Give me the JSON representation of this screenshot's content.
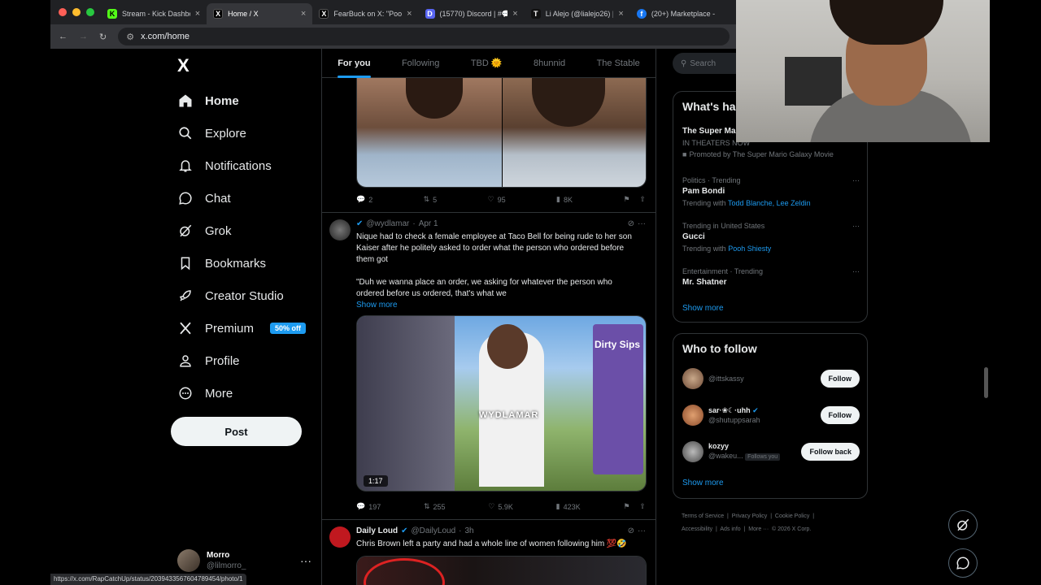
{
  "browser": {
    "tabs": [
      {
        "title": "Stream - Kick Dashbo",
        "icon": "K",
        "icon_color": "#53fc18",
        "active": false
      },
      {
        "title": "Home / X",
        "icon": "X",
        "icon_color": "#000000",
        "active": true
      },
      {
        "title": "FearBuck on X: \"Pooh",
        "icon": "X",
        "icon_color": "#000000",
        "active": false
      },
      {
        "title": "(15770) Discord | #💬",
        "icon": "D",
        "icon_color": "#5865f2",
        "active": false
      },
      {
        "title": "Li Alejo (@lialejo26) |",
        "icon": "T",
        "icon_color": "#111111",
        "active": false
      },
      {
        "title": "(20+) Marketplace -",
        "icon": "f",
        "icon_color": "#1877f2",
        "active": false
      }
    ],
    "url": "x.com/home",
    "status_url": "https://x.com/RapCatchUp/status/2039433567604789454/photo/1"
  },
  "nav": {
    "logo": "X",
    "items": [
      {
        "label": "Home",
        "icon": "home-icon",
        "active": true
      },
      {
        "label": "Explore",
        "icon": "search-icon"
      },
      {
        "label": "Notifications",
        "icon": "bell-icon"
      },
      {
        "label": "Chat",
        "icon": "chat-icon"
      },
      {
        "label": "Grok",
        "icon": "grok-icon"
      },
      {
        "label": "Bookmarks",
        "icon": "bookmark-icon"
      },
      {
        "label": "Creator Studio",
        "icon": "rocket-icon"
      },
      {
        "label": "Premium",
        "icon": "x-icon",
        "badge": "50% off"
      },
      {
        "label": "Profile",
        "icon": "person-icon"
      },
      {
        "label": "More",
        "icon": "more-circle-icon"
      }
    ],
    "post_label": "Post",
    "account": {
      "name": "Morro",
      "handle": "@lilmorro_"
    }
  },
  "timeline": {
    "tabs": [
      "For you",
      "Following",
      "TBD 🌞",
      "8hunnid",
      "The Stable"
    ],
    "post1_actions": {
      "replies": "2",
      "reposts": "5",
      "likes": "95",
      "views": "8K"
    },
    "post2": {
      "handle": "@wydlamar",
      "date": "Apr 1",
      "text1": "Nique had to check a female employee at Taco Bell for being rude to her son Kaiser after he politely asked to order what the person who ordered before them got",
      "text2": "\"Duh we wanna place an order, we asking for whatever the person who ordered before us ordered, that's what we",
      "show_more": "Show more",
      "duration": "1:17",
      "watermark": "WYDLAMAR",
      "sign_text": "Dirty Sips",
      "actions": {
        "replies": "197",
        "reposts": "255",
        "likes": "5.9K",
        "views": "423K"
      }
    },
    "post3": {
      "name": "Daily Loud",
      "handle": "@DailyLoud",
      "date": "3h",
      "text": "Chris Brown left a party and had a whole line of women following him 💯🤣"
    }
  },
  "right": {
    "search_placeholder": "Search",
    "whats_happening": {
      "title": "What's ha",
      "promo": {
        "name": "The Super Ma",
        "sub": "IN THEATERS NOW",
        "promoted": "Promoted by The Super Mario Galaxy Movie"
      },
      "trends": [
        {
          "context": "Politics · Trending",
          "name": "Pam Bondi",
          "with_label": "Trending with",
          "with": "Todd Blanche, Lee Zeldin"
        },
        {
          "context": "Trending in United States",
          "name": "Gucci",
          "with_label": "Trending with",
          "with": "Pooh Shiesty"
        },
        {
          "context": "Entertainment · Trending",
          "name": "Mr. Shatner",
          "with_label": "",
          "with": ""
        }
      ],
      "show_more": "Show more"
    },
    "who_to_follow": {
      "title": "Who to follow",
      "users": [
        {
          "name": "",
          "handle": "@ittskassy",
          "button": "Follow",
          "follows_you": ""
        },
        {
          "name": "sar·❀☾·uhh",
          "handle": "@shutuppsarah",
          "button": "Follow",
          "follows_you": ""
        },
        {
          "name": "kozyy",
          "handle": "@wakeu...",
          "button": "Follow back",
          "follows_you": "Follows you"
        }
      ],
      "show_more": "Show more"
    },
    "footer": {
      "links": [
        "Terms of Service",
        "|",
        "Privacy Policy",
        "|",
        "Cookie Policy",
        "|"
      ],
      "links2": [
        "Accessibility",
        "|",
        "Ads info",
        "|",
        "More ···",
        "© 2026 X Corp."
      ]
    }
  }
}
